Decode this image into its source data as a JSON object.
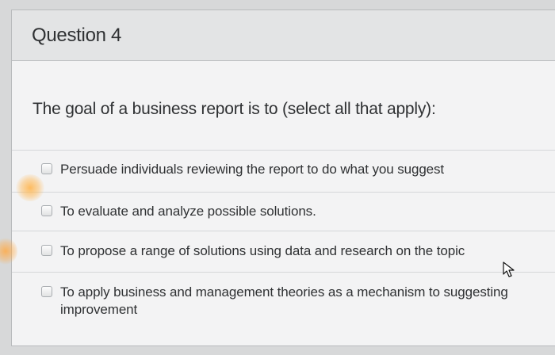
{
  "question": {
    "title": "Question 4",
    "prompt": "The goal of a business report is to (select all that apply):",
    "options": [
      {
        "label": "Persuade individuals reviewing the report to do what you suggest",
        "checked": false
      },
      {
        "label": "To evaluate and analyze possible solutions.",
        "checked": false
      },
      {
        "label": "To propose a range of solutions using data and research on the topic",
        "checked": false
      },
      {
        "label": "To apply business and management theories as a mechanism to suggesting improvement",
        "checked": false
      }
    ]
  },
  "icons": {
    "cursor": "mouse-cursor-icon",
    "checkbox": "checkbox-icon"
  },
  "colors": {
    "background": "#d7d8d9",
    "card": "#f3f3f4",
    "header": "#e3e4e5",
    "text": "#2f3133"
  }
}
